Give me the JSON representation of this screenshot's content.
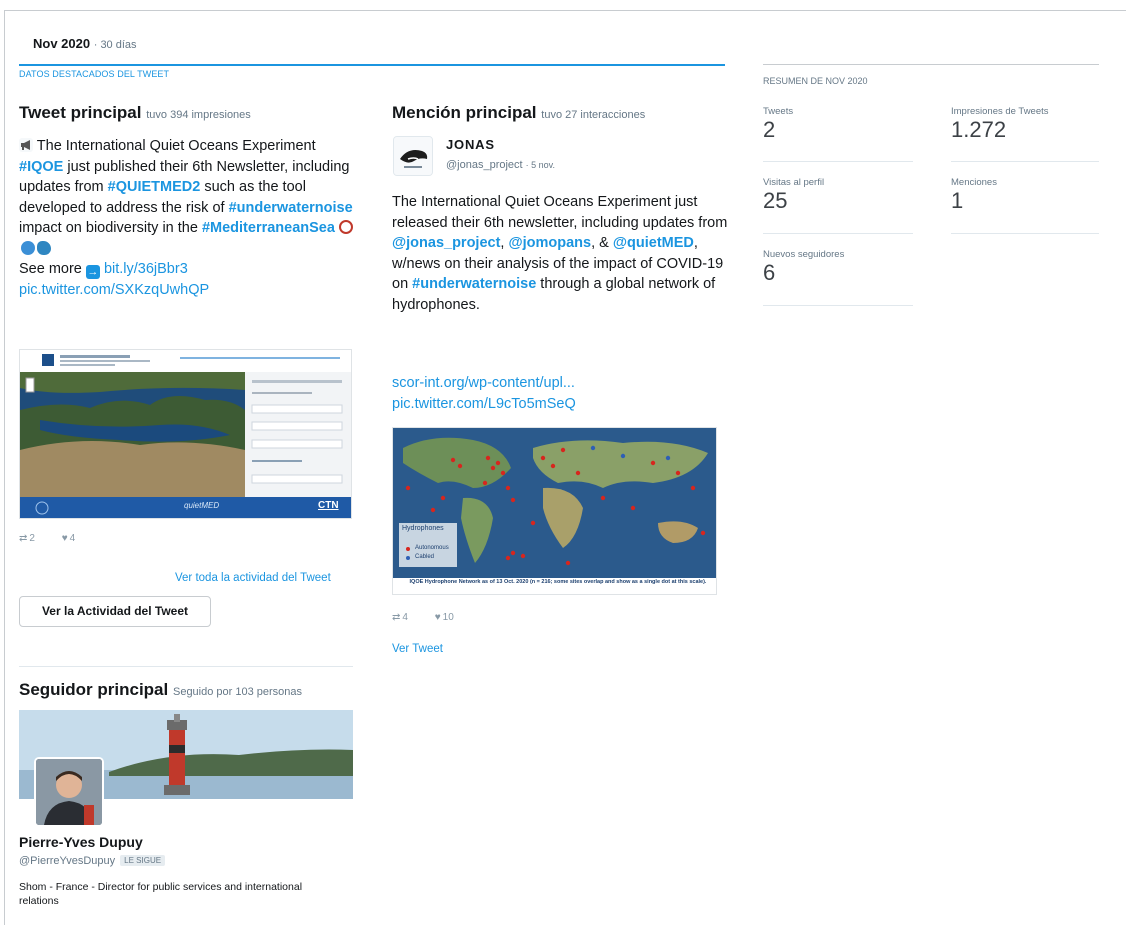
{
  "header": {
    "period": "Nov 2020",
    "days": "· 30 días"
  },
  "highlights": {
    "section_label": "DATOS DESTACADOS DEL TWEET"
  },
  "top_tweet": {
    "title": "Tweet principal",
    "sub": "tuvo 394 impresiones",
    "text_p1": " The International Quiet Oceans Experiment ",
    "tag1": "#IQOE",
    "text_p2": " just published their 6th Newsletter, including updates from ",
    "tag2": "#QUIETMED2",
    "text_p3": " such as the tool developed to address the risk of ",
    "tag3": "#underwaternoise",
    "text_p4": " impact on biodiversity in the ",
    "tag4": "#MediterraneanSea",
    "see_more": "See more",
    "link1": "bit.ly/36jBbr3",
    "link2": "pic.twitter.com/SXKzqUwhQP",
    "retweets": "2",
    "likes": "4",
    "view_all": "Ver toda la actividad del Tweet",
    "button": "Ver la Actividad del Tweet",
    "map_footer_brand": "CTN",
    "map_footer_mid": "quietMED"
  },
  "top_mention": {
    "title": "Mención principal",
    "sub": "tuvo 27 interacciones",
    "name": "JONAS",
    "handle": "@jonas_project",
    "date": "· 5 nov.",
    "text_p1": "The International Quiet Oceans Experiment just released their 6th newsletter, including updates from ",
    "m1": "@jonas_project",
    "text_p2": ", ",
    "m2": "@jomopans",
    "text_p3": ", & ",
    "m3": "@quietMED",
    "text_p4": ", w/news on their analysis of the impact of COVID-19 on ",
    "tag": "#underwaternoise",
    "text_p5": " through a global network of hydrophones.",
    "link1": "scor-int.org/wp-content/upl...",
    "link2": "pic.twitter.com/L9cTo5mSeQ",
    "retweets": "4",
    "likes": "10",
    "view_tweet": "Ver Tweet",
    "map_legend_title": "Hydrophones",
    "map_legend_a": "Autonomous",
    "map_legend_b": "Cabled",
    "map_caption": "IQOE Hydrophone Network as of 13 Oct. 2020 (n = 216; some sites overlap and show as a single dot at this scale)."
  },
  "top_follower": {
    "title": "Seguidor principal",
    "sub": "Seguido por 103 personas",
    "name": "Pierre-Yves Dupuy",
    "handle": "@PierreYvesDupuy",
    "badge": "LE SIGUE",
    "bio": "Shom - France - Director for public services and international relations"
  },
  "summary": {
    "label": "RESUMEN DE NOV 2020",
    "tweets_label": "Tweets",
    "tweets_value": "2",
    "impressions_label": "Impresiones de Tweets",
    "impressions_value": "1.272",
    "visits_label": "Visitas al perfil",
    "visits_value": "25",
    "mentions_label": "Menciones",
    "mentions_value": "1",
    "followers_label": "Nuevos seguidores",
    "followers_value": "6"
  },
  "colors": {
    "accent": "#1b95e0",
    "muted": "#657786",
    "ocean": "#1c3f6e"
  }
}
